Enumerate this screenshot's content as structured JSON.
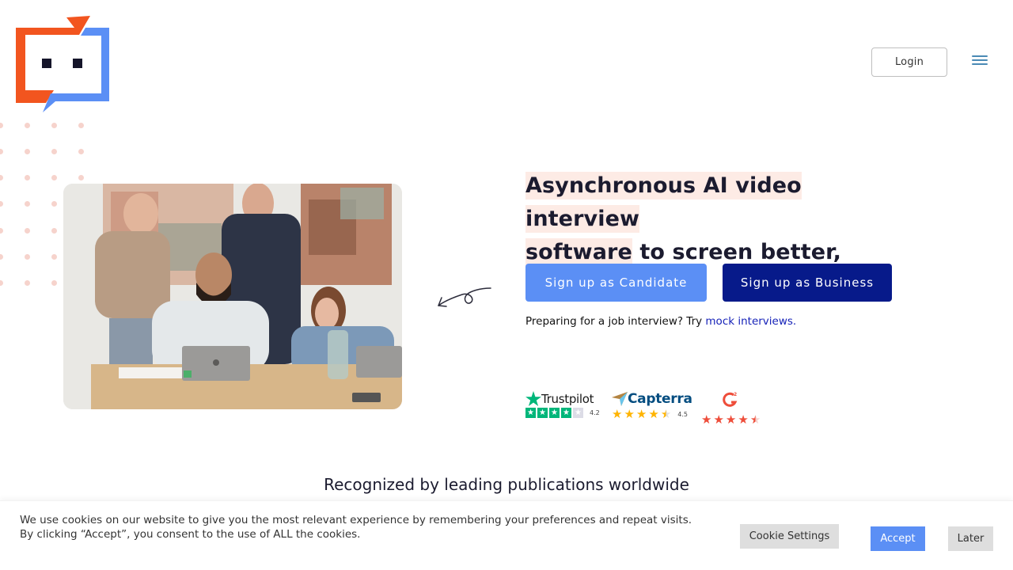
{
  "header": {
    "logo_alt": "Company logo",
    "login_label": "Login",
    "menu_icon": "hamburger-icon"
  },
  "colors": {
    "logo_orange": "#f2551f",
    "logo_blue": "#5b8ff5",
    "primary_light": "#5b8ff5",
    "primary_dark": "#071a8a",
    "highlight": "#fdebe5",
    "link": "#1622b8",
    "dots": "#f6d3cc"
  },
  "hero": {
    "headline_highlight": "Asynchronous AI video interview software",
    "headline_highlight_line1": "Asynchronous AI video interview",
    "headline_highlight_line2": "software",
    "headline_rest": " to screen better, faster.",
    "image_alt": "Team of four people smiling at a laptop in an office",
    "cta_candidate": "Sign up as Candidate",
    "cta_business": "Sign up as Business",
    "prep_text": "Preparing for a job interview? Try ",
    "prep_link": "mock interviews.",
    "decor_icon": "curly-arrow-icon"
  },
  "ratings": [
    {
      "brand": "Trustpilot",
      "score": "4.2",
      "stars": 4.2,
      "icon": "trustpilot-star-icon"
    },
    {
      "brand": "Capterra",
      "score": "4.5",
      "stars": 4.5,
      "icon": "capterra-logo-icon"
    },
    {
      "brand": "G2",
      "score": "",
      "stars": 4.5,
      "icon": "g2-logo-icon"
    }
  ],
  "recognized_heading": "Recognized by leading publications worldwide",
  "cookie": {
    "text": "We use cookies on our website to give you the most relevant experience by remembering your preferences and repeat visits. By clicking “Accept”, you consent to the use of ALL the cookies.",
    "settings_label": "Cookie Settings",
    "accept_label": "Accept",
    "later_label": "Later"
  }
}
